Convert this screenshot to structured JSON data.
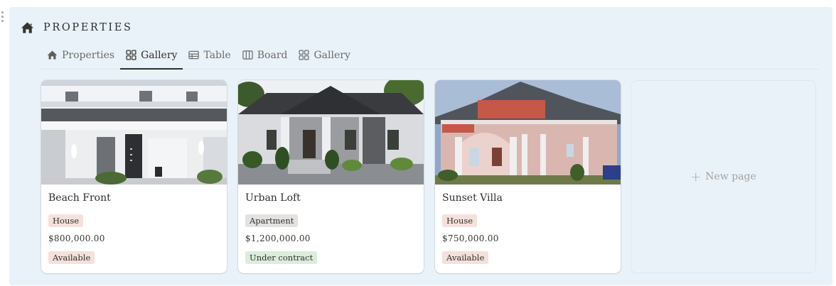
{
  "database": {
    "title": "PROPERTIES"
  },
  "tabs": [
    {
      "label": "Properties",
      "icon": "home-icon"
    },
    {
      "label": "Gallery",
      "icon": "gallery-icon",
      "active": true
    },
    {
      "label": "Table",
      "icon": "table-icon"
    },
    {
      "label": "Board",
      "icon": "board-icon"
    },
    {
      "label": "Gallery",
      "icon": "gallery-icon"
    }
  ],
  "cards": [
    {
      "name": "Beach Front",
      "type": "House",
      "type_color": "#f4e1db",
      "price": "$800,000.00",
      "status": "Available",
      "status_color": "#f4e1db"
    },
    {
      "name": "Urban Loft",
      "type": "Apartment",
      "type_color": "#e3e2e0",
      "price": "$1,200,000.00",
      "status": "Under contract",
      "status_color": "#dbeddb"
    },
    {
      "name": "Sunset Villa",
      "type": "House",
      "type_color": "#f4e1db",
      "price": "$750,000.00",
      "status": "Available",
      "status_color": "#f4e1db"
    }
  ],
  "new_page": {
    "label": "New page"
  },
  "colors": {
    "panel_bg": "#e9f2f9",
    "text": "#2f2f2f",
    "muted": "#a3a3a3"
  }
}
